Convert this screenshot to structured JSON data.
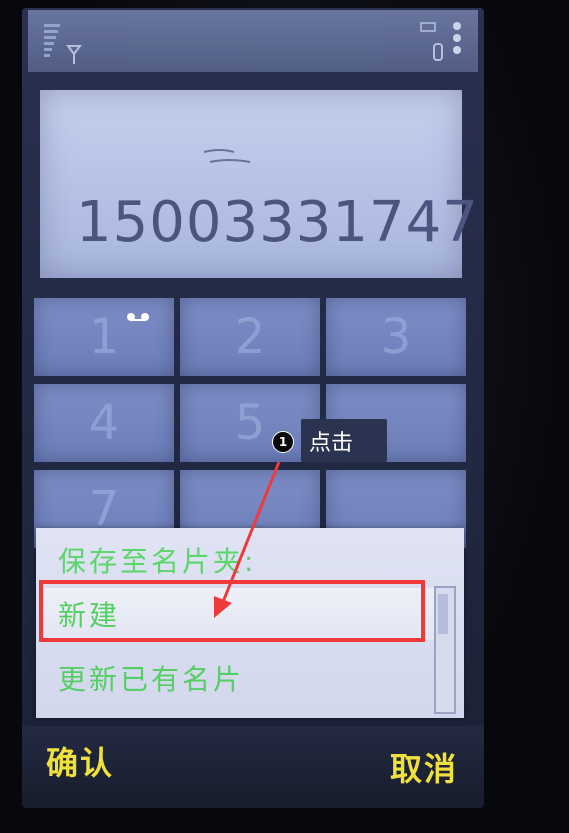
{
  "dialer": {
    "number": "15003331747",
    "keys": [
      "1",
      "2",
      "3",
      "4",
      "5",
      "",
      "7",
      "",
      ""
    ]
  },
  "save_menu": {
    "title": "保存至名片夹:",
    "items": [
      {
        "label": "新建",
        "selected": true
      },
      {
        "label": "更新已有名片",
        "selected": false
      }
    ]
  },
  "softkeys": {
    "left": "确认",
    "right": "取消"
  },
  "annotation": {
    "step": "1",
    "text": "点击"
  },
  "colors": {
    "menu_text": "#54cf63",
    "softkey_text": "#f0e03e",
    "highlight": "#f03a3a"
  }
}
